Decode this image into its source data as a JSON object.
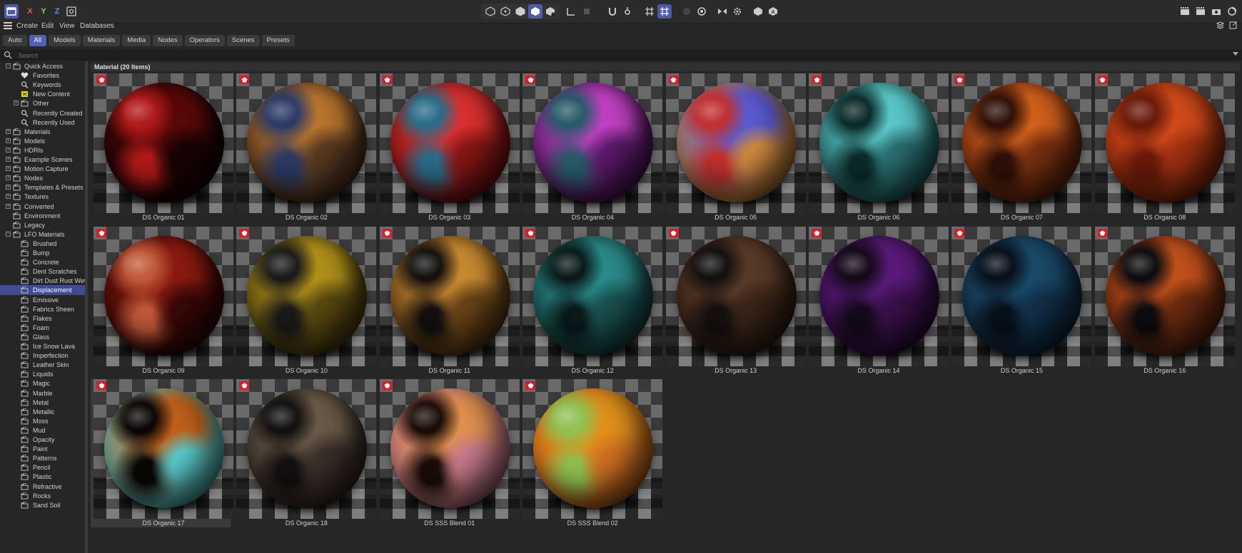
{
  "toolbar": {
    "axis_x": "X",
    "axis_y": "Y",
    "axis_z": "Z",
    "accent": "#4d5aa8"
  },
  "menu": {
    "items": [
      "Create",
      "Edit",
      "View",
      "Databases"
    ]
  },
  "filter_tabs": [
    {
      "label": "Auto",
      "active": false
    },
    {
      "label": "All",
      "active": true
    },
    {
      "label": "Models",
      "active": false
    },
    {
      "label": "Materials",
      "active": false
    },
    {
      "label": "Media",
      "active": false
    },
    {
      "label": "Nodes",
      "active": false
    },
    {
      "label": "Operators",
      "active": false
    },
    {
      "label": "Scenes",
      "active": false
    },
    {
      "label": "Presets",
      "active": false
    }
  ],
  "search": {
    "placeholder": "Search",
    "value": ""
  },
  "sidebar": {
    "items": [
      {
        "label": "Quick Access",
        "level": 0,
        "expander": "-",
        "icon": "folder-icon"
      },
      {
        "label": "Favorites",
        "level": 1,
        "expander": "",
        "icon": "heart-icon"
      },
      {
        "label": "Keywords",
        "level": 1,
        "expander": "",
        "icon": "search-icon"
      },
      {
        "label": "New Content",
        "level": 1,
        "expander": "",
        "icon": "new-content-icon"
      },
      {
        "label": "Other",
        "level": 1,
        "expander": "+",
        "icon": "folder-icon"
      },
      {
        "label": "Recently Created",
        "level": 1,
        "expander": "",
        "icon": "search-icon"
      },
      {
        "label": "Recently Used",
        "level": 1,
        "expander": "",
        "icon": "search-icon"
      },
      {
        "label": "Materials",
        "level": 0,
        "expander": "+",
        "icon": "folder-icon"
      },
      {
        "label": "Models",
        "level": 0,
        "expander": "+",
        "icon": "folder-icon"
      },
      {
        "label": "HDRIs",
        "level": 0,
        "expander": "+",
        "icon": "folder-icon"
      },
      {
        "label": "Example Scenes",
        "level": 0,
        "expander": "+",
        "icon": "folder-icon"
      },
      {
        "label": "Motion Capture",
        "level": 0,
        "expander": "+",
        "icon": "folder-icon"
      },
      {
        "label": "Nodes",
        "level": 0,
        "expander": "+",
        "icon": "folder-icon"
      },
      {
        "label": "Templates & Presets",
        "level": 0,
        "expander": "+",
        "icon": "folder-icon"
      },
      {
        "label": "Textures",
        "level": 0,
        "expander": "+",
        "icon": "folder-icon"
      },
      {
        "label": "Converted",
        "level": 0,
        "expander": "+",
        "icon": "folder-icon"
      },
      {
        "label": "Environment",
        "level": 0,
        "expander": "",
        "icon": "folder-icon"
      },
      {
        "label": "Legacy",
        "level": 0,
        "expander": "",
        "icon": "folder-icon"
      },
      {
        "label": "LFO Materials",
        "level": 0,
        "expander": "-",
        "icon": "folder-icon"
      },
      {
        "label": "Brushed",
        "level": 1,
        "expander": "",
        "icon": "folder-icon"
      },
      {
        "label": "Bump",
        "level": 1,
        "expander": "",
        "icon": "folder-icon"
      },
      {
        "label": "Concrete",
        "level": 1,
        "expander": "",
        "icon": "folder-icon"
      },
      {
        "label": "Dent Scratches",
        "level": 1,
        "expander": "",
        "icon": "folder-icon"
      },
      {
        "label": "Dirt Dust Rust Wet",
        "level": 1,
        "expander": "",
        "icon": "folder-icon"
      },
      {
        "label": "Displacement",
        "level": 1,
        "expander": "",
        "icon": "folder-icon",
        "selected": true
      },
      {
        "label": "Emissive",
        "level": 1,
        "expander": "",
        "icon": "folder-icon"
      },
      {
        "label": "Fabrics Sheen",
        "level": 1,
        "expander": "",
        "icon": "folder-icon"
      },
      {
        "label": "Flakes",
        "level": 1,
        "expander": "",
        "icon": "folder-icon"
      },
      {
        "label": "Foam",
        "level": 1,
        "expander": "",
        "icon": "folder-icon"
      },
      {
        "label": "Glass",
        "level": 1,
        "expander": "",
        "icon": "folder-icon"
      },
      {
        "label": "Ice Snow Lava",
        "level": 1,
        "expander": "",
        "icon": "folder-icon"
      },
      {
        "label": "Imperfection",
        "level": 1,
        "expander": "",
        "icon": "folder-icon"
      },
      {
        "label": "Leather Skin",
        "level": 1,
        "expander": "",
        "icon": "folder-icon"
      },
      {
        "label": "Liquids",
        "level": 1,
        "expander": "",
        "icon": "folder-icon"
      },
      {
        "label": "Magic",
        "level": 1,
        "expander": "",
        "icon": "folder-icon"
      },
      {
        "label": "Marble",
        "level": 1,
        "expander": "",
        "icon": "folder-icon"
      },
      {
        "label": "Metal",
        "level": 1,
        "expander": "",
        "icon": "folder-icon"
      },
      {
        "label": "Metallic",
        "level": 1,
        "expander": "",
        "icon": "folder-icon"
      },
      {
        "label": "Moss",
        "level": 1,
        "expander": "",
        "icon": "folder-icon"
      },
      {
        "label": "Mud",
        "level": 1,
        "expander": "",
        "icon": "folder-icon"
      },
      {
        "label": "Opacity",
        "level": 1,
        "expander": "",
        "icon": "folder-icon"
      },
      {
        "label": "Paint",
        "level": 1,
        "expander": "",
        "icon": "folder-icon"
      },
      {
        "label": "Patterns",
        "level": 1,
        "expander": "",
        "icon": "folder-icon"
      },
      {
        "label": "Pencil",
        "level": 1,
        "expander": "",
        "icon": "folder-icon"
      },
      {
        "label": "Plastic",
        "level": 1,
        "expander": "",
        "icon": "folder-icon"
      },
      {
        "label": "Refractive",
        "level": 1,
        "expander": "",
        "icon": "folder-icon"
      },
      {
        "label": "Rocks",
        "level": 1,
        "expander": "",
        "icon": "folder-icon"
      },
      {
        "label": "Sand Soil",
        "level": 1,
        "expander": "",
        "icon": "folder-icon"
      }
    ]
  },
  "grid": {
    "header": "Material (20 Items)",
    "items": [
      {
        "label": "DS Organic 01",
        "colors": [
          "#5a0808",
          "#b01a1a",
          "#1a0404"
        ]
      },
      {
        "label": "DS Organic 02",
        "colors": [
          "#b8742e",
          "#2c3b66",
          "#5a3a20"
        ]
      },
      {
        "label": "DS Organic 03",
        "colors": [
          "#d83030",
          "#2a6c88",
          "#8a1616"
        ]
      },
      {
        "label": "DS Organic 04",
        "colors": [
          "#c040c0",
          "#2a5a6a",
          "#5a1a6a"
        ]
      },
      {
        "label": "DS Organic 05",
        "colors": [
          "#5a5ad0",
          "#c03030",
          "#d08a40"
        ]
      },
      {
        "label": "DS Organic 06",
        "colors": [
          "#5ac8c8",
          "#0c2a2a",
          "#2a7070"
        ]
      },
      {
        "label": "DS Organic 07",
        "colors": [
          "#d0601a",
          "#301008",
          "#7a3010"
        ]
      },
      {
        "label": "DS Organic 08",
        "colors": [
          "#d04a1a",
          "#6a1a0a",
          "#a03010"
        ]
      },
      {
        "label": "DS Organic 09",
        "colors": [
          "#8a1a10",
          "#c05a3a",
          "#3a0806"
        ]
      },
      {
        "label": "DS Organic 10",
        "colors": [
          "#b0901a",
          "#1a1a1a",
          "#5a4a10"
        ]
      },
      {
        "label": "DS Organic 11",
        "colors": [
          "#c88a30",
          "#141010",
          "#6a4418"
        ]
      },
      {
        "label": "DS Organic 12",
        "colors": [
          "#2a8a8a",
          "#0a1a1a",
          "#1a5050"
        ]
      },
      {
        "label": "DS Organic 13",
        "colors": [
          "#5a3a28",
          "#141010",
          "#3a2418"
        ]
      },
      {
        "label": "DS Organic 14",
        "colors": [
          "#5a1a7a",
          "#140a1a",
          "#3a104a"
        ]
      },
      {
        "label": "DS Organic 15",
        "colors": [
          "#1a4a6a",
          "#08101a",
          "#12304a"
        ]
      },
      {
        "label": "DS Organic 16",
        "colors": [
          "#c0501a",
          "#0c0c10",
          "#6a2a10"
        ]
      },
      {
        "label": "DS Organic 17",
        "colors": [
          "#c0601a",
          "#0a0606",
          "#5ac8c8"
        ]
      },
      {
        "label": "DS Organic 18",
        "colors": [
          "#6a5a48",
          "#121010",
          "#3a3028"
        ]
      },
      {
        "label": "DS SSS Blend 01",
        "colors": [
          "#e09050",
          "#1a0c08",
          "#c87a8a"
        ]
      },
      {
        "label": "DS SSS Blend 02",
        "colors": [
          "#e0901a",
          "#90c050",
          "#d07020"
        ]
      }
    ]
  }
}
